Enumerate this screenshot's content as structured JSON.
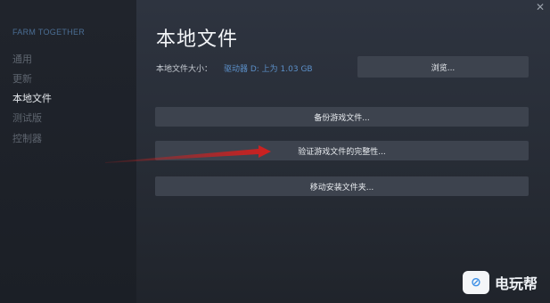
{
  "sidebar": {
    "game_title": "FARM TOGETHER",
    "items": [
      {
        "label": "通用",
        "active": false
      },
      {
        "label": "更新",
        "active": false
      },
      {
        "label": "本地文件",
        "active": true
      },
      {
        "label": "测试版",
        "active": false
      },
      {
        "label": "控制器",
        "active": false
      }
    ]
  },
  "main": {
    "title": "本地文件",
    "size_label": "本地文件大小：",
    "size_value": "驱动器 D: 上为 1.03 GB",
    "browse_label": "浏览...",
    "backup_label": "备份游戏文件...",
    "verify_label": "验证游戏文件的完整性...",
    "move_label": "移动安装文件夹..."
  },
  "window": {
    "close_symbol": "✕"
  },
  "watermark": {
    "text": "电玩帮",
    "logo_glyph": "⊘"
  },
  "colors": {
    "sidebar_bg": "#1f232b",
    "main_bg": "#2e3440",
    "button_bg": "#3d434e",
    "accent_link": "#5b8fc8",
    "arrow": "#d0201f"
  }
}
